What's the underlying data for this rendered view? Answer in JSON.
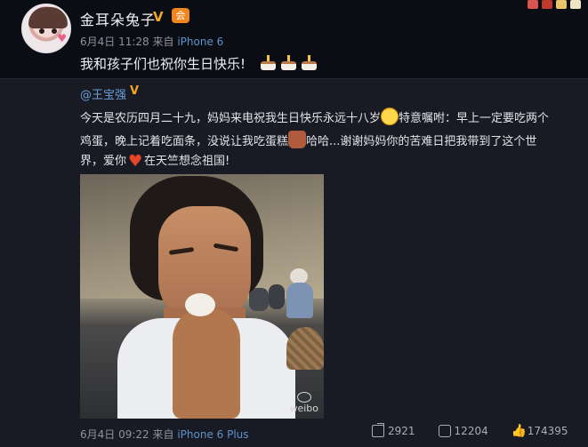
{
  "post": {
    "author": "金耳朵兔子",
    "verified_mark": "V",
    "member_badge": "会",
    "time": "6月4日 11:28",
    "source_prefix": "来自",
    "source": "iPhone 6",
    "text": "我和孩子们也祝你生日快乐!",
    "emoji_count": 3
  },
  "repost": {
    "author": "@王宝强",
    "verified_mark": "V",
    "line1a": "今天是农历四月二十九，妈妈来电祝我生日快乐永远十八岁",
    "line1b": "特意嘱咐：早上一定要吃两个",
    "line2a": "鸡蛋，晚上记着吃面条，没说让我吃蛋糕",
    "line2b": "哈哈...谢谢妈妈你的苦难日把我带到了这个世",
    "line3a": "界，爱你",
    "line3b": "在天竺想念祖国!",
    "watermark": "weibo",
    "time": "6月4日 09:22",
    "source_prefix": "来自",
    "source": "iPhone 6 Plus",
    "shares": "2921",
    "comments": "12204",
    "likes": "174395"
  },
  "icons": [
    "share-icon",
    "comment-icon",
    "like-icon",
    "cake-icon",
    "grin-emoji-icon",
    "heart-emoji-icon"
  ],
  "colors": {
    "link": "#6aa0d8",
    "verified": "#f5a623",
    "source": "#5f93c9",
    "background": "#181a24"
  }
}
